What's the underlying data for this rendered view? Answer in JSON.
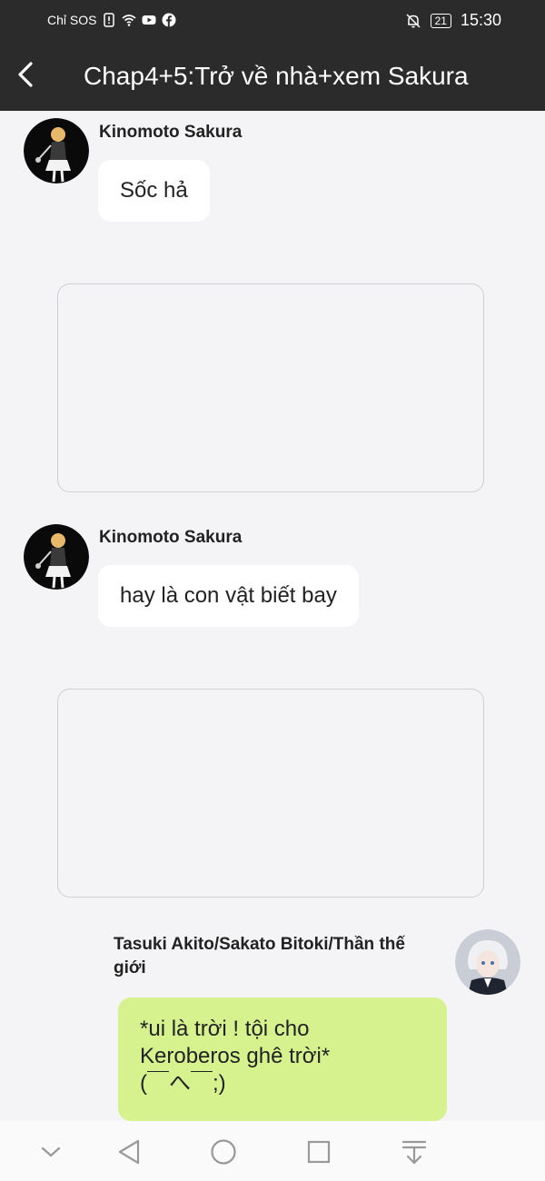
{
  "status_bar": {
    "carrier": "Chỉ SOS",
    "battery": "21",
    "time": "15:30",
    "icons": [
      "sim-alert-icon",
      "wifi-icon",
      "youtube-icon",
      "facebook-icon",
      "mute-bell-icon",
      "battery-icon"
    ]
  },
  "header": {
    "title": "Chap4+5:Trở về nhà+xem Sakura",
    "back_icon": "chevron-left-icon"
  },
  "messages": [
    {
      "sender": "Kinomoto Sakura",
      "text": "Sốc hả",
      "side": "left"
    },
    {
      "sender": "Kinomoto Sakura",
      "text": "hay là con vật biết bay",
      "side": "left"
    },
    {
      "sender_line1": "Tasuki Akito/Sakato Bitoki/Thần thế",
      "sender_line2": "giới",
      "line1": "*ui là trời ! tội cho",
      "line2": "Keroberos ghê trời*",
      "line3": "(￣へ￣;)",
      "side": "right"
    }
  ],
  "colors": {
    "bar": "#2b2b2b",
    "background": "#f4f4f6",
    "own_bubble": "#d5f28f",
    "other_bubble": "#ffffff"
  },
  "navbar": {
    "icons": [
      "chevron-down-icon",
      "back-triangle-icon",
      "home-circle-icon",
      "recents-square-icon",
      "pull-down-icon"
    ]
  }
}
